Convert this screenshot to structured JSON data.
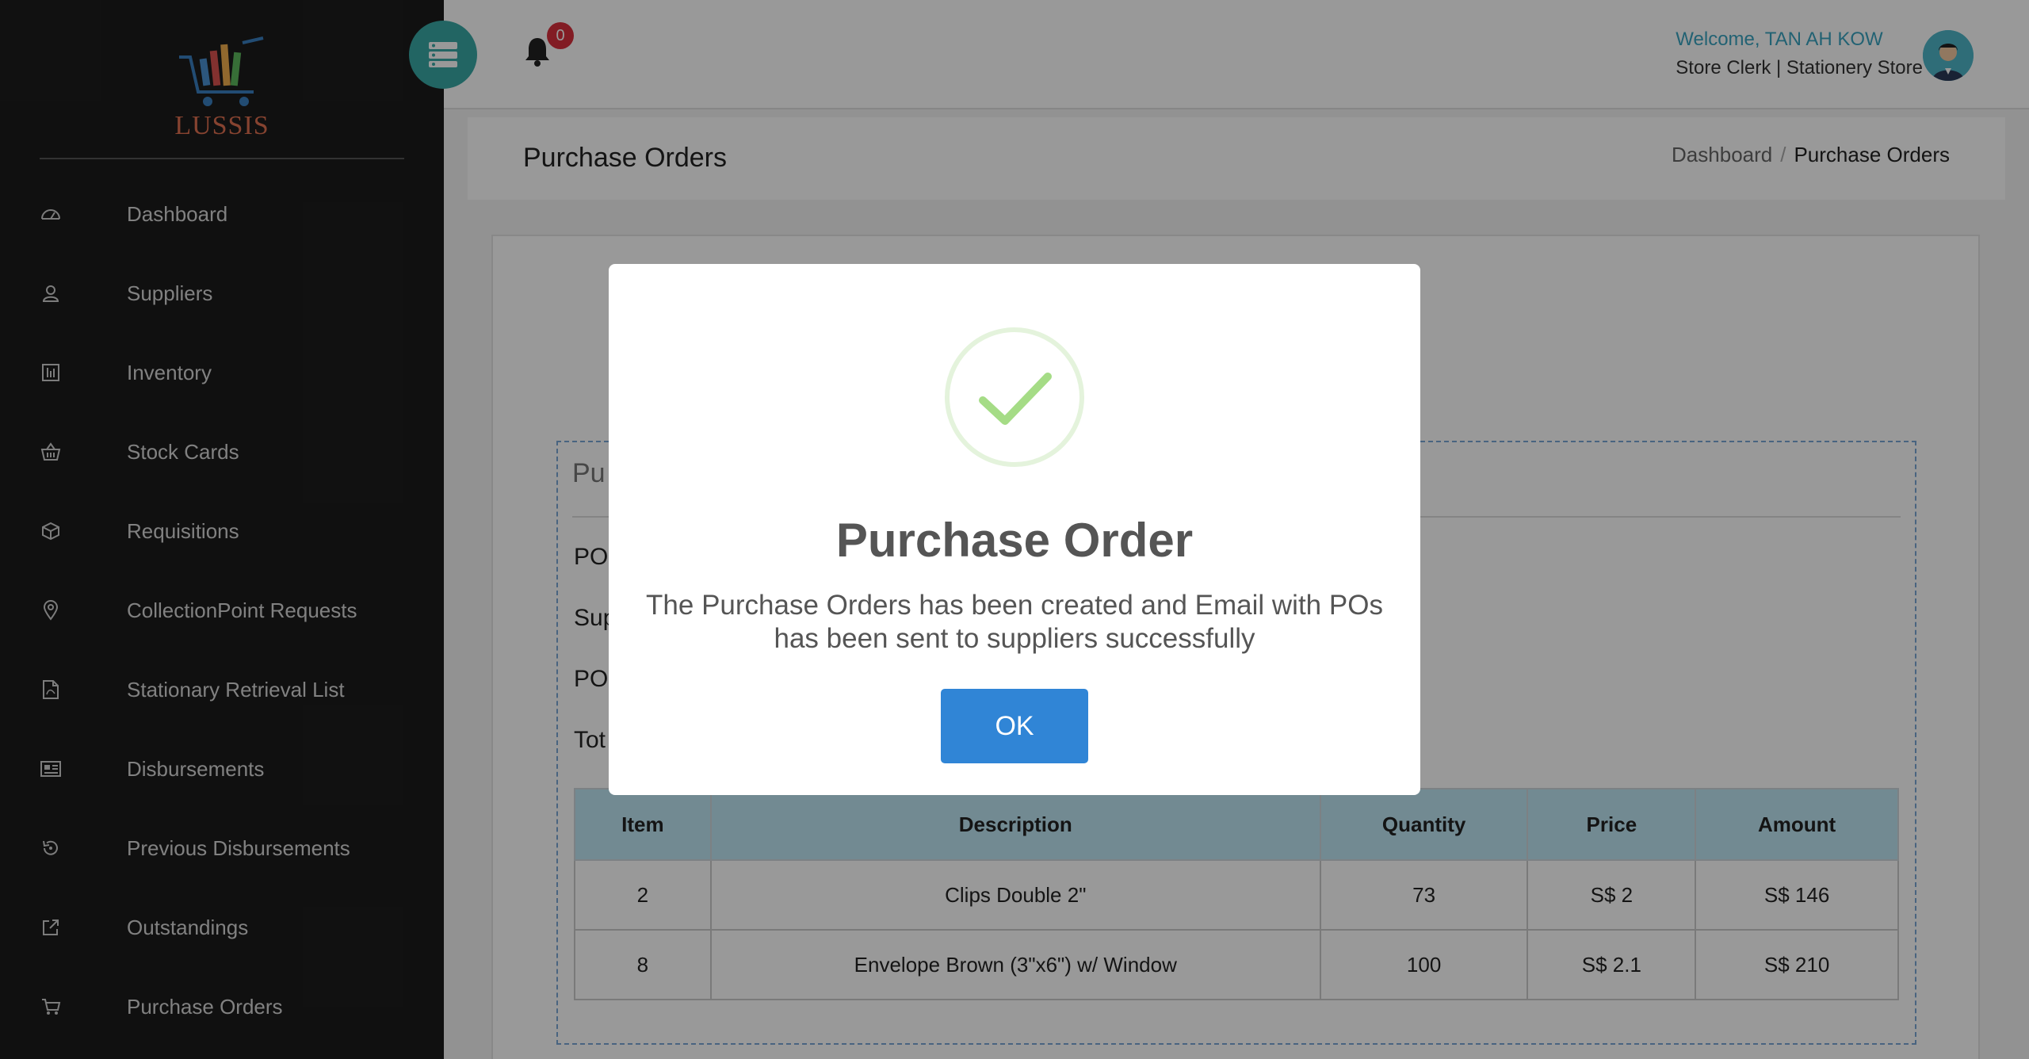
{
  "brand": {
    "logo_text": "LUSSIS"
  },
  "sidebar": {
    "items": [
      {
        "label": "Dashboard",
        "icon": "dashboard-icon"
      },
      {
        "label": "Suppliers",
        "icon": "user-icon"
      },
      {
        "label": "Inventory",
        "icon": "inventory-icon"
      },
      {
        "label": "Stock Cards",
        "icon": "basket-icon"
      },
      {
        "label": "Requisitions",
        "icon": "box-icon"
      },
      {
        "label": "CollectionPoint Requests",
        "icon": "location-pin-icon"
      },
      {
        "label": "Stationary Retrieval List",
        "icon": "pdf-file-icon"
      },
      {
        "label": "Disbursements",
        "icon": "newspaper-icon"
      },
      {
        "label": "Previous Disbursements",
        "icon": "history-icon"
      },
      {
        "label": "Outstandings",
        "icon": "external-link-icon"
      },
      {
        "label": "Purchase Orders",
        "icon": "cart-icon"
      }
    ]
  },
  "header": {
    "notification_count": "0",
    "welcome": "Welcome, TAN AH KOW",
    "role": "Store Clerk | Stationery Store"
  },
  "page": {
    "title": "Purchase Orders",
    "breadcrumb": {
      "home": "Dashboard",
      "separator": "/",
      "current": "Purchase Orders"
    }
  },
  "po": {
    "heading_partial": "Pu",
    "field_1_partial": "PO",
    "field_2_partial": "Sup",
    "field_3_partial": "PO",
    "field_4_partial": "Tot",
    "columns": [
      "Item",
      "Description",
      "Quantity",
      "Price",
      "Amount"
    ],
    "rows": [
      [
        "2",
        "Clips Double 2\"",
        "73",
        "S$ 2",
        "S$ 146"
      ],
      [
        "8",
        "Envelope Brown (3\"x6\") w/ Window",
        "100",
        "S$ 2.1",
        "S$ 210"
      ]
    ]
  },
  "modal": {
    "icon": "success-check-icon",
    "title": "Purchase Order",
    "message": "The Purchase Orders has been created and Email with POs has been sent to suppliers successfully",
    "ok_label": "OK"
  },
  "colors": {
    "sidebar_bg": "#1c1c1c",
    "accent_teal": "#3aa9a6",
    "badge_red": "#d9303d",
    "welcome_blue": "#3aa3c0",
    "table_header": "#bfe6f4",
    "ok_button": "#3085d6",
    "check_green": "#a5dc86"
  }
}
